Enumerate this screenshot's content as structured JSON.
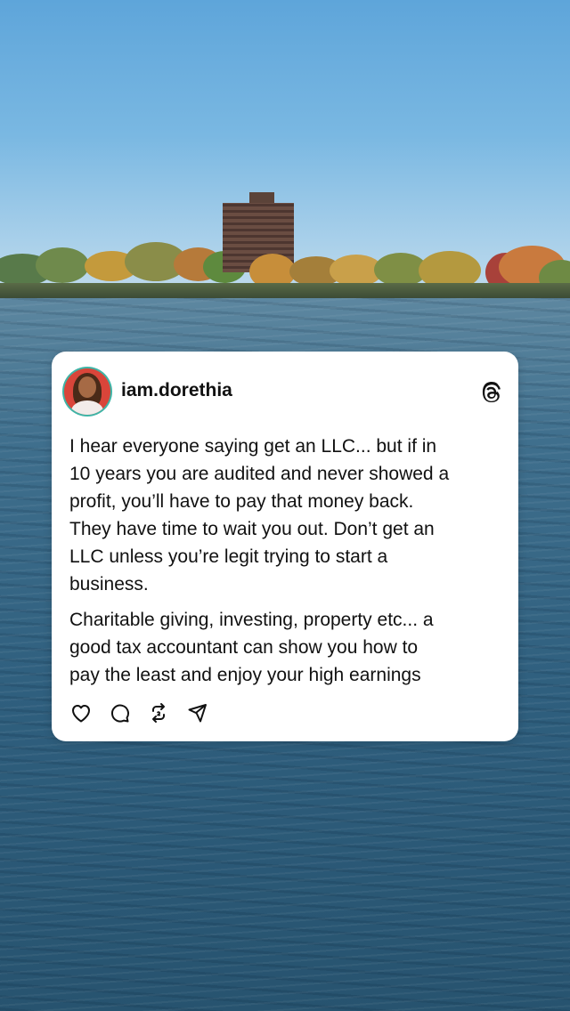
{
  "post": {
    "username": "iam.dorethia",
    "paragraphs": [
      "I hear everyone saying get an LLC... but if in\n10 years you are audited and never showed a\nprofit, you’ll have to pay that money back.\nThey have time to wait you out. Don’t get an\nLLC unless you’re legit trying to start a\nbusiness.",
      "Charitable giving, investing, property etc... a\ngood tax accountant can show you how to\npay the least and enjoy your high earnings"
    ]
  },
  "icons": {
    "brand": "threads-icon",
    "actions": [
      "heart-icon",
      "comment-icon",
      "repost-icon",
      "share-icon"
    ]
  },
  "colors": {
    "card_background": "#ffffff",
    "text": "#111111",
    "avatar_ring": "#3fb4a6",
    "sky": "#7ab8e2",
    "water": "#2f5f7e"
  }
}
